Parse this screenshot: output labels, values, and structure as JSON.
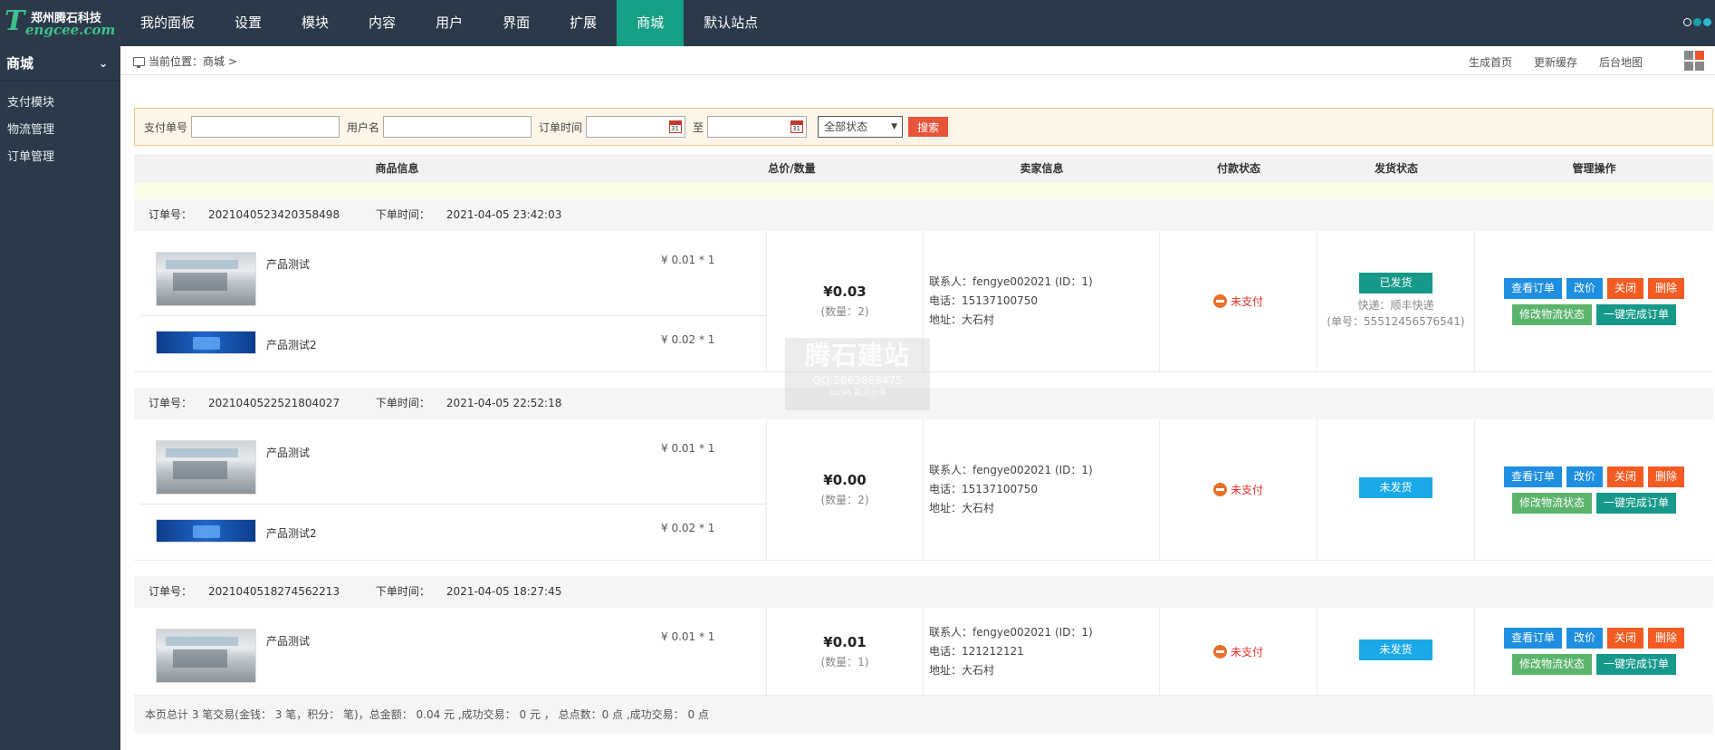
{
  "logo": {
    "cn": "郑州腾石科技",
    "t": "T",
    "en_a": "eng",
    "en_b": "cee",
    "en_c": ".com"
  },
  "nav": [
    {
      "label": "我的面板",
      "active": false
    },
    {
      "label": "设置",
      "active": false
    },
    {
      "label": "模块",
      "active": false
    },
    {
      "label": "内容",
      "active": false
    },
    {
      "label": "用户",
      "active": false
    },
    {
      "label": "界面",
      "active": false
    },
    {
      "label": "扩展",
      "active": false
    },
    {
      "label": "商城",
      "active": true
    },
    {
      "label": "默认站点",
      "active": false
    }
  ],
  "sidebar": {
    "title": "商城",
    "items": [
      {
        "label": "支付模块"
      },
      {
        "label": "物流管理"
      },
      {
        "label": "订单管理"
      }
    ]
  },
  "crumb": {
    "text": "当前位置：商城 >"
  },
  "crumb_links": [
    {
      "label": "生成首页"
    },
    {
      "label": "更新缓存"
    },
    {
      "label": "后台地图"
    }
  ],
  "search": {
    "pay_no_label": "支付单号",
    "pay_no_value": "",
    "username_label": "用户名",
    "username_value": "",
    "time_label": "订单时间",
    "to_label": "至",
    "date_from": "",
    "date_to": "",
    "status_selected": "全部状态",
    "button": "搜索"
  },
  "columns": {
    "goods": "商品信息",
    "total": "总价/数量",
    "seller": "卖家信息",
    "pay": "付款状态",
    "ship": "发货状态",
    "ops": "管理操作"
  },
  "labels": {
    "order_no": "订单号：",
    "order_time": "下单时间：",
    "contact": "联系人：",
    "phone": "电话：",
    "address": "地址："
  },
  "buttons": {
    "view": "查看订单",
    "reprice": "改价",
    "close": "关闭",
    "delete": "删除",
    "edit_logistics": "修改物流状态",
    "complete": "一键完成订单"
  },
  "orders": [
    {
      "order_no": "2021040523420358498",
      "time": "2021-04-05 23:42:03",
      "goods": [
        {
          "name": "产品测试",
          "price": "¥ 0.01 * 1"
        },
        {
          "name": "产品测试2",
          "price": "¥ 0.02 * 1"
        }
      ],
      "total": "¥0.03",
      "qty": "(数量：2)",
      "contact": "fengye002021 (ID：1)",
      "phone": "15137100750",
      "address": "大石村",
      "pay_status": "未支付",
      "ship_status": "已发货",
      "express": "快递：顺丰快递",
      "tracking": "(单号：55512456576541)"
    },
    {
      "order_no": "2021040522521804027",
      "time": "2021-04-05 22:52:18",
      "goods": [
        {
          "name": "产品测试",
          "price": "¥ 0.01 * 1"
        },
        {
          "name": "产品测试2",
          "price": "¥ 0.02 * 1"
        }
      ],
      "total": "¥0.00",
      "qty": "(数量：2)",
      "contact": "fengye002021 (ID：1)",
      "phone": "15137100750",
      "address": "大石村",
      "pay_status": "未支付",
      "ship_status": "未发货"
    },
    {
      "order_no": "2021040518274562213",
      "time": "2021-04-05 18:27:45",
      "goods": [
        {
          "name": "产品测试",
          "price": "¥ 0.01 * 1"
        }
      ],
      "total": "¥0.01",
      "qty": "(数量：1)",
      "contact": "fengye002021 (ID：1)",
      "phone": "121212121",
      "address": "大石村",
      "pay_status": "未支付",
      "ship_status": "未发货"
    }
  ],
  "watermark": {
    "line1": "腾石建站",
    "line2": "QQ:2863868475",
    "line3": "Tcc98 勘测分享"
  },
  "summary": "本页总计 3 笔交易(金钱： 3 笔，积分： 笔)，总金额： 0.04  元 ,成功交易： 0  元  ，  总点数：0  点 ,成功交易： 0  点"
}
